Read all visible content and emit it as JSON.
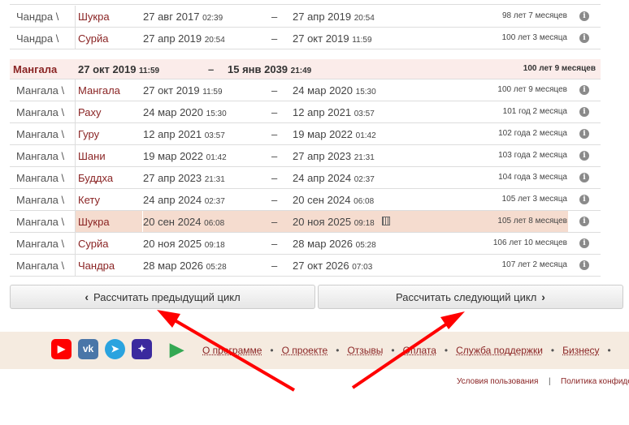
{
  "rows_top": [
    {
      "lord": "Чандра \\",
      "sub": "Шукра",
      "start_date": "27 авг 2017",
      "start_time": "02:39",
      "end_date": "27 апр 2019",
      "end_time": "20:54",
      "duration": "98 лет 7 месяцев"
    },
    {
      "lord": "Чандра \\",
      "sub": "Сурйа",
      "start_date": "27 апр 2019",
      "start_time": "20:54",
      "end_date": "27 окт 2019",
      "end_time": "11:59",
      "duration": "100 лет 3 месяца"
    }
  ],
  "period_header": {
    "name": "Мангала",
    "start_date": "27 окт 2019",
    "start_time": "11:59",
    "end_date": "15 янв 2039",
    "end_time": "21:49",
    "duration": "100 лет 9 месяцев"
  },
  "dash": "–",
  "info_icon_glyph": "i",
  "rows": [
    {
      "lord": "Мангала \\",
      "sub": "Мангала",
      "start_date": "27 окт 2019",
      "start_time": "11:59",
      "end_date": "24 мар 2020",
      "end_time": "15:30",
      "duration": "100 лет 9 месяцев"
    },
    {
      "lord": "Мангала \\",
      "sub": "Раху",
      "start_date": "24 мар 2020",
      "start_time": "15:30",
      "end_date": "12 апр 2021",
      "end_time": "03:57",
      "duration": "101 год 2 месяца"
    },
    {
      "lord": "Мангала \\",
      "sub": "Гуру",
      "start_date": "12 апр 2021",
      "start_time": "03:57",
      "end_date": "19 мар 2022",
      "end_time": "01:42",
      "duration": "102 года 2 месяца"
    },
    {
      "lord": "Мангала \\",
      "sub": "Шани",
      "start_date": "19 мар 2022",
      "start_time": "01:42",
      "end_date": "27 апр 2023",
      "end_time": "21:31",
      "duration": "103 года 2 месяца"
    },
    {
      "lord": "Мангала \\",
      "sub": "Буддха",
      "start_date": "27 апр 2023",
      "start_time": "21:31",
      "end_date": "24 апр 2024",
      "end_time": "02:37",
      "duration": "104 года 3 месяца"
    },
    {
      "lord": "Мангала \\",
      "sub": "Кету",
      "start_date": "24 апр 2024",
      "start_time": "02:37",
      "end_date": "20 сен 2024",
      "end_time": "06:08",
      "duration": "105 лет 3 месяца"
    },
    {
      "lord": "Мангала \\",
      "sub": "Шукра",
      "start_date": "20 сен 2024",
      "start_time": "06:08",
      "end_date": "20 ноя 2025",
      "end_time": "09:18",
      "duration": "105 лет 8 месяцев",
      "current": true
    },
    {
      "lord": "Мангала \\",
      "sub": "Сурйа",
      "start_date": "20 ноя 2025",
      "start_time": "09:18",
      "end_date": "28 мар 2026",
      "end_time": "05:28",
      "duration": "106 лет 10 месяцев"
    },
    {
      "lord": "Мангала \\",
      "sub": "Чандра",
      "start_date": "28 мар 2026",
      "start_time": "05:28",
      "end_date": "27 окт 2026",
      "end_time": "07:03",
      "duration": "107 лет 2 месяца"
    }
  ],
  "buttons": {
    "prev": "Рассчитать предыдущий цикл",
    "next": "Рассчитать следующий цикл"
  },
  "footer": {
    "social": [
      {
        "icon": "youtube-icon",
        "glyph": "▶",
        "color": "#ff0000"
      },
      {
        "icon": "vk-icon",
        "glyph": "vk",
        "color": "#4a76a8"
      },
      {
        "icon": "telegram-icon",
        "glyph": "➤",
        "color": "#2aa3df"
      },
      {
        "icon": "star-app-icon",
        "glyph": "✦",
        "color": "#3b2a9e"
      },
      {
        "icon": "google-play-icon",
        "glyph": "▶",
        "color": "#34a853"
      }
    ],
    "links": [
      "О программе",
      "О проекте",
      "Отзывы",
      "Оплата",
      "Служба поддержки",
      "Бизнесу"
    ],
    "bullet": "•",
    "legal": {
      "terms": "Условия пользования",
      "sep": "|",
      "privacy": "Политика конфиде"
    }
  },
  "colors": {
    "accent": "#8a2424",
    "highlight": "#f5dccf",
    "header_bg": "#fbecea",
    "footer_bg": "#f5ebe0",
    "arrow": "#ff0000"
  }
}
